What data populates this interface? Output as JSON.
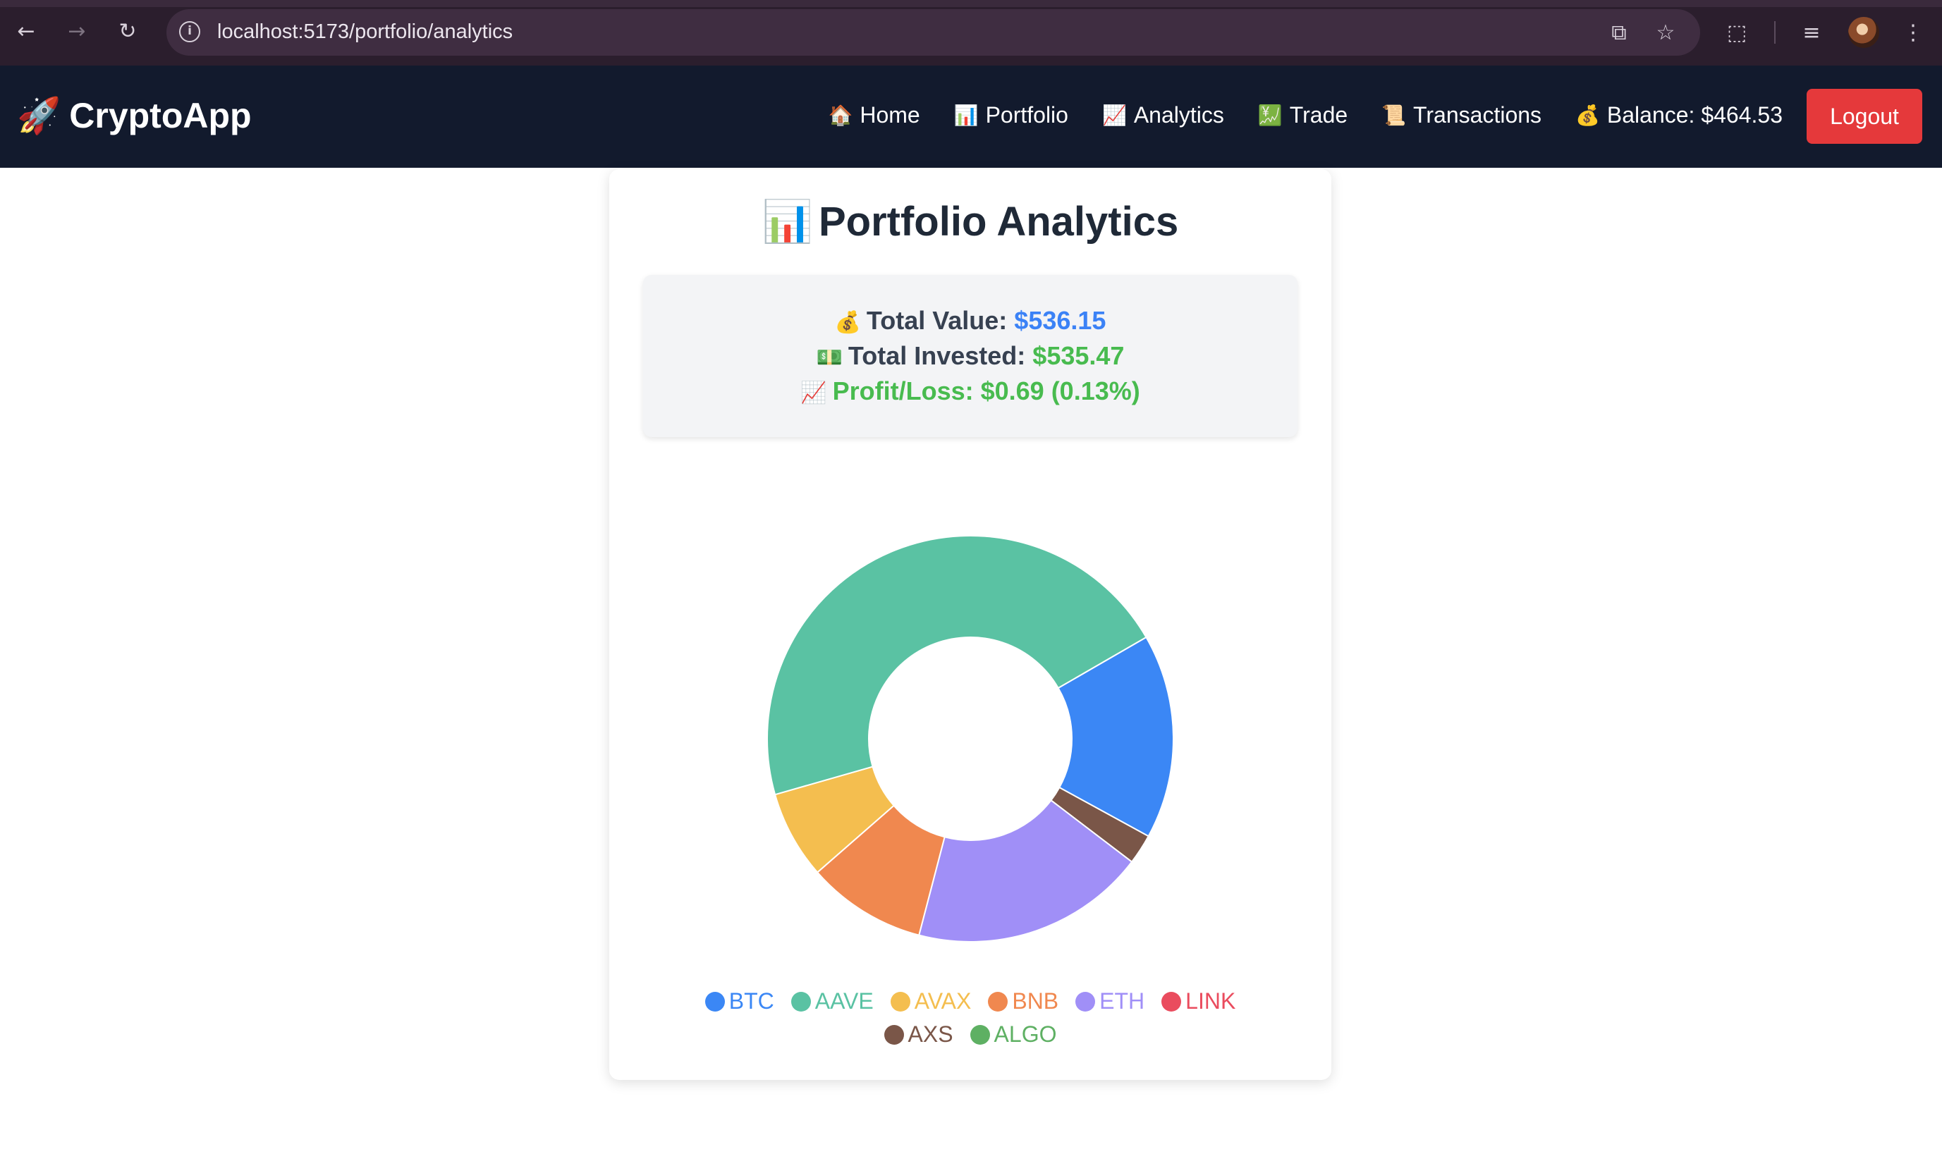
{
  "browser": {
    "url": "localhost:5173/portfolio/analytics"
  },
  "nav": {
    "brand": "CryptoApp",
    "brand_emoji": "🚀",
    "links": [
      {
        "emoji": "🏠",
        "label": "Home"
      },
      {
        "emoji": "📊",
        "label": "Portfolio"
      },
      {
        "emoji": "📈",
        "label": "Analytics"
      },
      {
        "emoji": "💹",
        "label": "Trade"
      },
      {
        "emoji": "📜",
        "label": "Transactions"
      }
    ],
    "balance_emoji": "💰",
    "balance": "Balance: $464.53",
    "logout": "Logout"
  },
  "page": {
    "title_emoji": "📊",
    "title": "Portfolio Analytics",
    "total_value_emoji": "💰",
    "total_value_label": "Total Value:",
    "total_value": "$536.15",
    "total_invested_emoji": "💵",
    "total_invested_label": "Total Invested:",
    "total_invested": "$535.47",
    "pl_emoji": "📈",
    "pl_text": "Profit/Loss: $0.69 (0.13%)"
  },
  "colors": {
    "BTC": "#3b87f5",
    "AAVE": "#5ac2a3",
    "AVAX": "#f4be4f",
    "BNB": "#f0884f",
    "ETH": "#a08ff7",
    "LINK": "#ea4c5e",
    "AXS": "#7a5648",
    "ALGO": "#5eb063",
    "accent": "#e5393b",
    "nav_bg": "#121a2d"
  },
  "chart_data": {
    "type": "pie",
    "donut": true,
    "labels": [
      "BTC",
      "AXS",
      "ETH",
      "BNB",
      "AVAX",
      "AAVE",
      "LINK",
      "ALGO"
    ],
    "values": [
      16.3,
      2.4,
      18.7,
      9.5,
      7.0,
      46.1,
      0,
      0
    ],
    "title": "",
    "legend_position": "bottom",
    "legend": [
      "BTC",
      "AAVE",
      "AVAX",
      "BNB",
      "ETH",
      "LINK",
      "AXS",
      "ALGO"
    ]
  }
}
